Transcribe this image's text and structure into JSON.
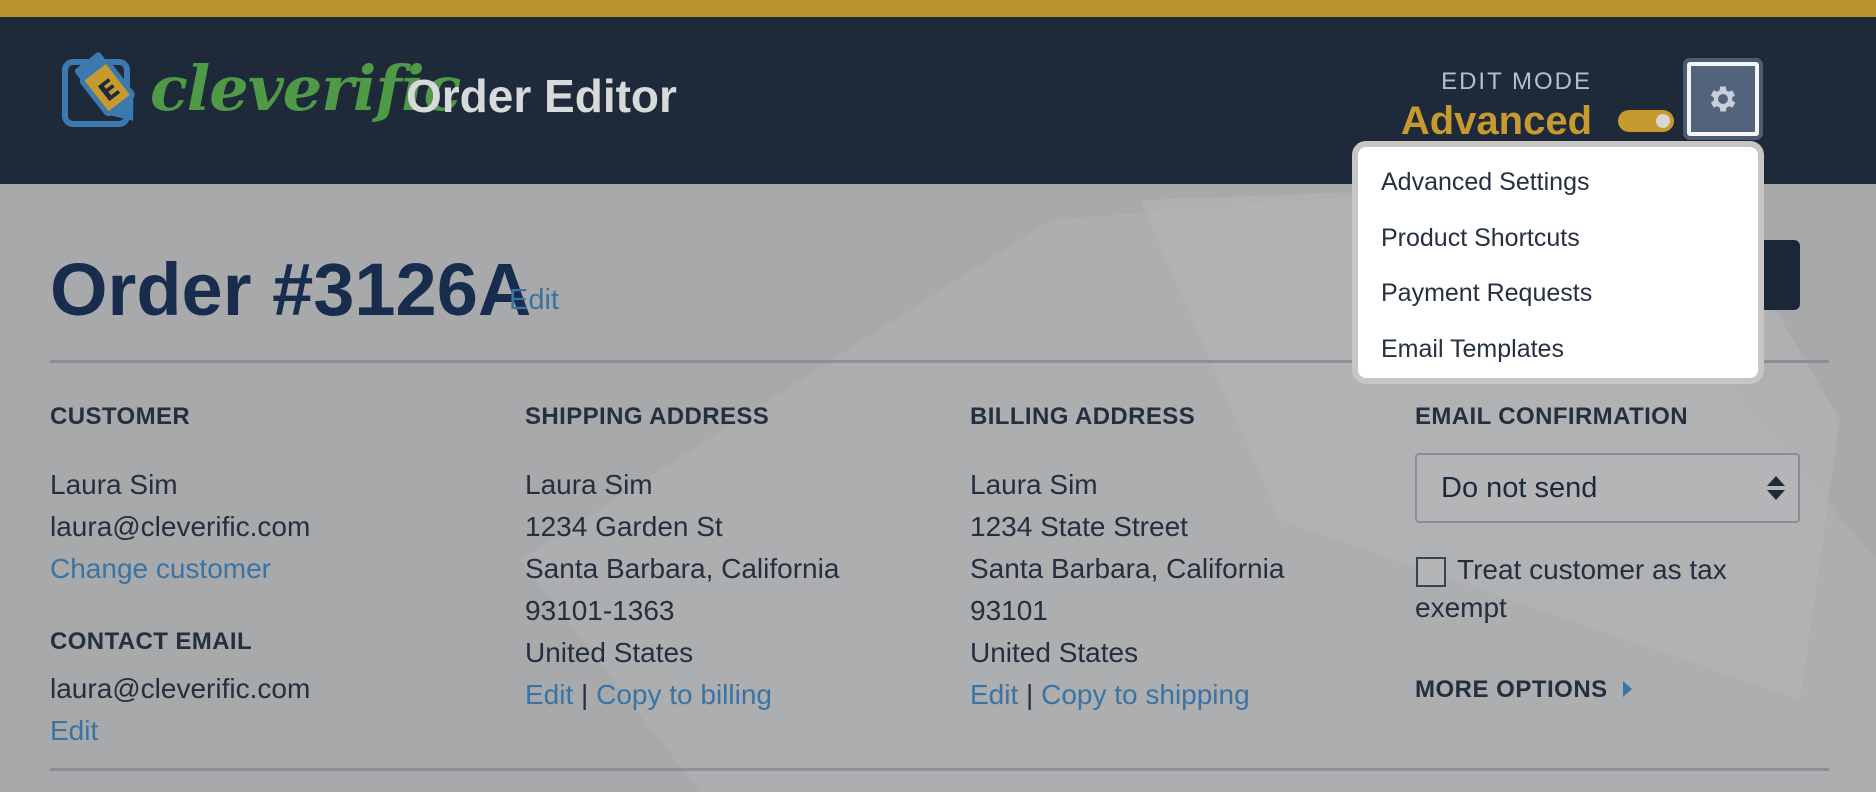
{
  "header": {
    "brand": "cleverific",
    "product": "Order Editor",
    "edit_mode_label": "EDIT MODE",
    "edit_mode_value": "Advanced"
  },
  "settings_menu": {
    "items": [
      {
        "label": "Advanced Settings"
      },
      {
        "label": "Product Shortcuts"
      },
      {
        "label": "Payment Requests"
      },
      {
        "label": "Email Templates"
      }
    ]
  },
  "order": {
    "title": "Order #3126A",
    "edit_label": "Edit"
  },
  "customer": {
    "heading": "CUSTOMER",
    "name": "Laura Sim",
    "email": "laura@cleverific.com",
    "change_label": "Change customer",
    "contact_heading": "CONTACT EMAIL",
    "contact_email": "laura@cleverific.com",
    "contact_edit_label": "Edit"
  },
  "shipping": {
    "heading": "SHIPPING ADDRESS",
    "lines": [
      "Laura Sim",
      "1234 Garden St",
      "Santa Barbara, California",
      "93101-1363",
      "United States"
    ],
    "edit_label": "Edit",
    "separator": "|",
    "copy_label": "Copy to billing"
  },
  "billing": {
    "heading": "BILLING ADDRESS",
    "lines": [
      "Laura Sim",
      "1234 State Street",
      "Santa Barbara, California",
      "93101",
      "United States"
    ],
    "edit_label": "Edit",
    "separator": "|",
    "copy_label": "Copy to shipping"
  },
  "email_confirmation": {
    "heading": "EMAIL CONFIRMATION",
    "selected": "Do not send",
    "tax_exempt_label": "Treat customer as tax exempt",
    "tax_exempt_checked": false,
    "more_options_label": "MORE OPTIONS"
  },
  "colors": {
    "accent_gold": "#c69a2f",
    "header_bg": "#1e2a3a",
    "link_blue": "#3b73a3",
    "brand_green": "#4f9a47"
  }
}
